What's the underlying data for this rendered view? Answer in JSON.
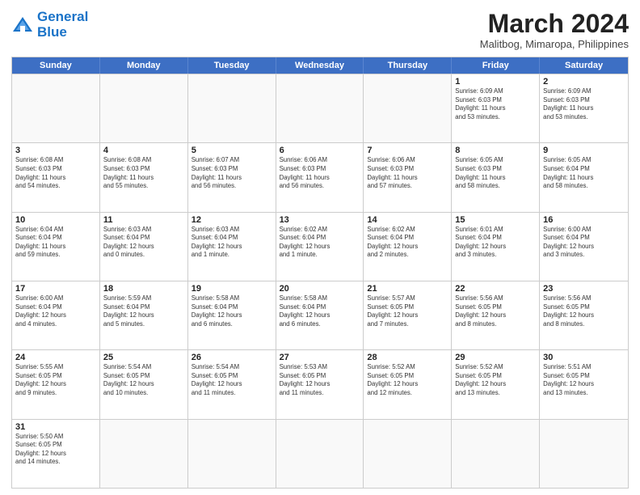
{
  "header": {
    "logo_line1": "General",
    "logo_line2": "Blue",
    "month_title": "March 2024",
    "location": "Malitbog, Mimaropa, Philippines"
  },
  "days_of_week": [
    "Sunday",
    "Monday",
    "Tuesday",
    "Wednesday",
    "Thursday",
    "Friday",
    "Saturday"
  ],
  "weeks": [
    [
      {
        "day": "",
        "info": ""
      },
      {
        "day": "",
        "info": ""
      },
      {
        "day": "",
        "info": ""
      },
      {
        "day": "",
        "info": ""
      },
      {
        "day": "",
        "info": ""
      },
      {
        "day": "1",
        "info": "Sunrise: 6:09 AM\nSunset: 6:03 PM\nDaylight: 11 hours\nand 53 minutes."
      },
      {
        "day": "2",
        "info": "Sunrise: 6:09 AM\nSunset: 6:03 PM\nDaylight: 11 hours\nand 53 minutes."
      }
    ],
    [
      {
        "day": "3",
        "info": "Sunrise: 6:08 AM\nSunset: 6:03 PM\nDaylight: 11 hours\nand 54 minutes."
      },
      {
        "day": "4",
        "info": "Sunrise: 6:08 AM\nSunset: 6:03 PM\nDaylight: 11 hours\nand 55 minutes."
      },
      {
        "day": "5",
        "info": "Sunrise: 6:07 AM\nSunset: 6:03 PM\nDaylight: 11 hours\nand 56 minutes."
      },
      {
        "day": "6",
        "info": "Sunrise: 6:06 AM\nSunset: 6:03 PM\nDaylight: 11 hours\nand 56 minutes."
      },
      {
        "day": "7",
        "info": "Sunrise: 6:06 AM\nSunset: 6:03 PM\nDaylight: 11 hours\nand 57 minutes."
      },
      {
        "day": "8",
        "info": "Sunrise: 6:05 AM\nSunset: 6:03 PM\nDaylight: 11 hours\nand 58 minutes."
      },
      {
        "day": "9",
        "info": "Sunrise: 6:05 AM\nSunset: 6:04 PM\nDaylight: 11 hours\nand 58 minutes."
      }
    ],
    [
      {
        "day": "10",
        "info": "Sunrise: 6:04 AM\nSunset: 6:04 PM\nDaylight: 11 hours\nand 59 minutes."
      },
      {
        "day": "11",
        "info": "Sunrise: 6:03 AM\nSunset: 6:04 PM\nDaylight: 12 hours\nand 0 minutes."
      },
      {
        "day": "12",
        "info": "Sunrise: 6:03 AM\nSunset: 6:04 PM\nDaylight: 12 hours\nand 1 minute."
      },
      {
        "day": "13",
        "info": "Sunrise: 6:02 AM\nSunset: 6:04 PM\nDaylight: 12 hours\nand 1 minute."
      },
      {
        "day": "14",
        "info": "Sunrise: 6:02 AM\nSunset: 6:04 PM\nDaylight: 12 hours\nand 2 minutes."
      },
      {
        "day": "15",
        "info": "Sunrise: 6:01 AM\nSunset: 6:04 PM\nDaylight: 12 hours\nand 3 minutes."
      },
      {
        "day": "16",
        "info": "Sunrise: 6:00 AM\nSunset: 6:04 PM\nDaylight: 12 hours\nand 3 minutes."
      }
    ],
    [
      {
        "day": "17",
        "info": "Sunrise: 6:00 AM\nSunset: 6:04 PM\nDaylight: 12 hours\nand 4 minutes."
      },
      {
        "day": "18",
        "info": "Sunrise: 5:59 AM\nSunset: 6:04 PM\nDaylight: 12 hours\nand 5 minutes."
      },
      {
        "day": "19",
        "info": "Sunrise: 5:58 AM\nSunset: 6:04 PM\nDaylight: 12 hours\nand 6 minutes."
      },
      {
        "day": "20",
        "info": "Sunrise: 5:58 AM\nSunset: 6:04 PM\nDaylight: 12 hours\nand 6 minutes."
      },
      {
        "day": "21",
        "info": "Sunrise: 5:57 AM\nSunset: 6:05 PM\nDaylight: 12 hours\nand 7 minutes."
      },
      {
        "day": "22",
        "info": "Sunrise: 5:56 AM\nSunset: 6:05 PM\nDaylight: 12 hours\nand 8 minutes."
      },
      {
        "day": "23",
        "info": "Sunrise: 5:56 AM\nSunset: 6:05 PM\nDaylight: 12 hours\nand 8 minutes."
      }
    ],
    [
      {
        "day": "24",
        "info": "Sunrise: 5:55 AM\nSunset: 6:05 PM\nDaylight: 12 hours\nand 9 minutes."
      },
      {
        "day": "25",
        "info": "Sunrise: 5:54 AM\nSunset: 6:05 PM\nDaylight: 12 hours\nand 10 minutes."
      },
      {
        "day": "26",
        "info": "Sunrise: 5:54 AM\nSunset: 6:05 PM\nDaylight: 12 hours\nand 11 minutes."
      },
      {
        "day": "27",
        "info": "Sunrise: 5:53 AM\nSunset: 6:05 PM\nDaylight: 12 hours\nand 11 minutes."
      },
      {
        "day": "28",
        "info": "Sunrise: 5:52 AM\nSunset: 6:05 PM\nDaylight: 12 hours\nand 12 minutes."
      },
      {
        "day": "29",
        "info": "Sunrise: 5:52 AM\nSunset: 6:05 PM\nDaylight: 12 hours\nand 13 minutes."
      },
      {
        "day": "30",
        "info": "Sunrise: 5:51 AM\nSunset: 6:05 PM\nDaylight: 12 hours\nand 13 minutes."
      }
    ],
    [
      {
        "day": "31",
        "info": "Sunrise: 5:50 AM\nSunset: 6:05 PM\nDaylight: 12 hours\nand 14 minutes."
      },
      {
        "day": "",
        "info": ""
      },
      {
        "day": "",
        "info": ""
      },
      {
        "day": "",
        "info": ""
      },
      {
        "day": "",
        "info": ""
      },
      {
        "day": "",
        "info": ""
      },
      {
        "day": "",
        "info": ""
      }
    ]
  ]
}
